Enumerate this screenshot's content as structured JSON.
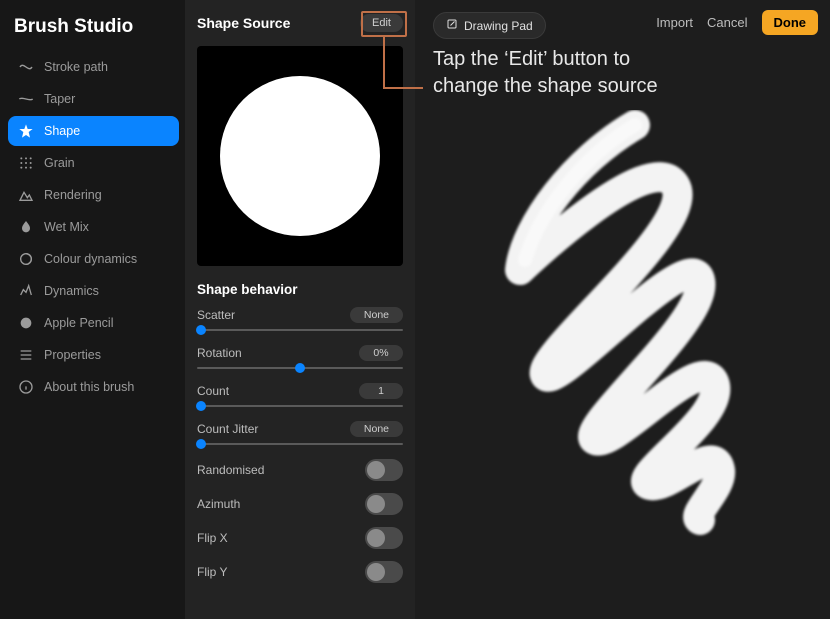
{
  "brand": "Brush Studio",
  "sidebar": {
    "items": [
      {
        "label": "Stroke path",
        "icon": "stroke-path-icon"
      },
      {
        "label": "Taper",
        "icon": "taper-icon"
      },
      {
        "label": "Shape",
        "icon": "shape-icon"
      },
      {
        "label": "Grain",
        "icon": "grain-icon"
      },
      {
        "label": "Rendering",
        "icon": "rendering-icon"
      },
      {
        "label": "Wet Mix",
        "icon": "wet-mix-icon"
      },
      {
        "label": "Colour dynamics",
        "icon": "colour-dynamics-icon"
      },
      {
        "label": "Dynamics",
        "icon": "dynamics-icon"
      },
      {
        "label": "Apple Pencil",
        "icon": "apple-pencil-icon"
      },
      {
        "label": "Properties",
        "icon": "properties-icon"
      },
      {
        "label": "About this brush",
        "icon": "about-icon"
      }
    ],
    "active_index": 2
  },
  "mid": {
    "title": "Shape Source",
    "edit_label": "Edit",
    "behavior_title": "Shape behavior",
    "sliders": [
      {
        "label": "Scatter",
        "value": "None",
        "pos": 0.02
      },
      {
        "label": "Rotation",
        "value": "0%",
        "pos": 0.5
      },
      {
        "label": "Count",
        "value": "1",
        "pos": 0.02
      },
      {
        "label": "Count Jitter",
        "value": "None",
        "pos": 0.02
      }
    ],
    "toggles": [
      {
        "label": "Randomised",
        "on": false
      },
      {
        "label": "Azimuth",
        "on": false
      },
      {
        "label": "Flip X",
        "on": false
      },
      {
        "label": "Flip Y",
        "on": false
      }
    ]
  },
  "topbar": {
    "import": "Import",
    "cancel": "Cancel",
    "done": "Done",
    "drawing_pad": "Drawing Pad"
  },
  "callout": {
    "line1": "Tap the ‘Edit’ button to",
    "line2": "change the shape source"
  },
  "colors": {
    "accent": "#0a84ff",
    "highlight": "#c07048",
    "done": "#f5a623"
  }
}
